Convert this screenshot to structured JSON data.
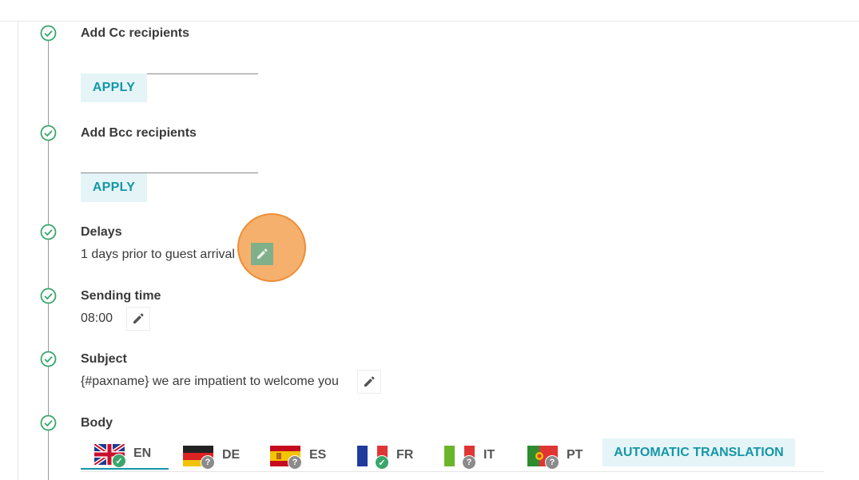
{
  "steps": {
    "cc": {
      "title": "Add Cc recipients",
      "apply_label": "APPLY"
    },
    "bcc": {
      "title": "Add Bcc recipients",
      "apply_label": "APPLY"
    },
    "delays": {
      "title": "Delays",
      "value": "1 days prior to guest arrival"
    },
    "sending_time": {
      "title": "Sending time",
      "value": "08:00"
    },
    "subject": {
      "title": "Subject",
      "value": "{#paxname} we are impatient to welcome you"
    },
    "body": {
      "title": "Body"
    }
  },
  "languages": [
    {
      "code": "EN",
      "icon": "uk-flag-icon",
      "status": "translated",
      "active": true
    },
    {
      "code": "DE",
      "icon": "germany-flag-icon",
      "status": "unknown",
      "active": false
    },
    {
      "code": "ES",
      "icon": "spain-flag-icon",
      "status": "unknown",
      "active": false
    },
    {
      "code": "FR",
      "icon": "france-flag-icon",
      "status": "translated",
      "active": false
    },
    {
      "code": "IT",
      "icon": "italy-flag-icon",
      "status": "unknown",
      "active": false
    },
    {
      "code": "PT",
      "icon": "portugal-flag-icon",
      "status": "unknown",
      "active": false
    }
  ],
  "auto_translation_label": "AUTOMATIC TRANSLATION",
  "colors": {
    "accent": "#1596a8",
    "accent_bg": "#e5f5f7",
    "check_green": "#3aa66a",
    "highlight": "#f4a253"
  }
}
